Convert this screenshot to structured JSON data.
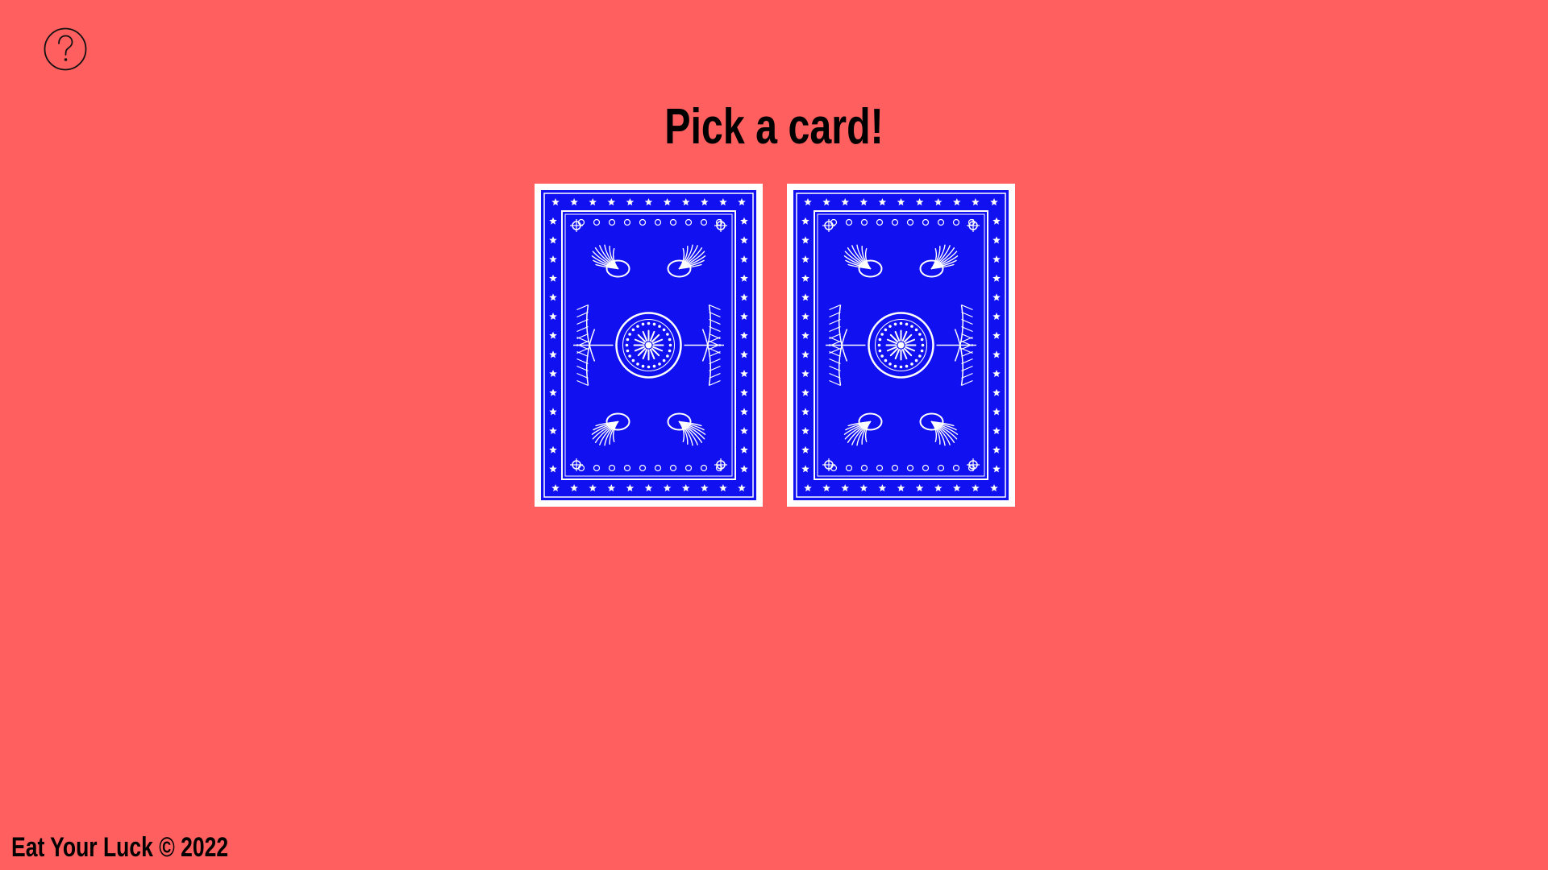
{
  "header": {
    "help_icon": "question-circle-icon",
    "title": "Pick a card!"
  },
  "cards": [
    {
      "face": "card-back-pattern",
      "color": "#1010f0"
    },
    {
      "face": "card-back-pattern",
      "color": "#1010f0"
    }
  ],
  "footer": {
    "text": "Eat Your Luck © 2022"
  },
  "colors": {
    "background": "#ff5f5f",
    "card_blue": "#1010f0",
    "text": "#000000"
  }
}
